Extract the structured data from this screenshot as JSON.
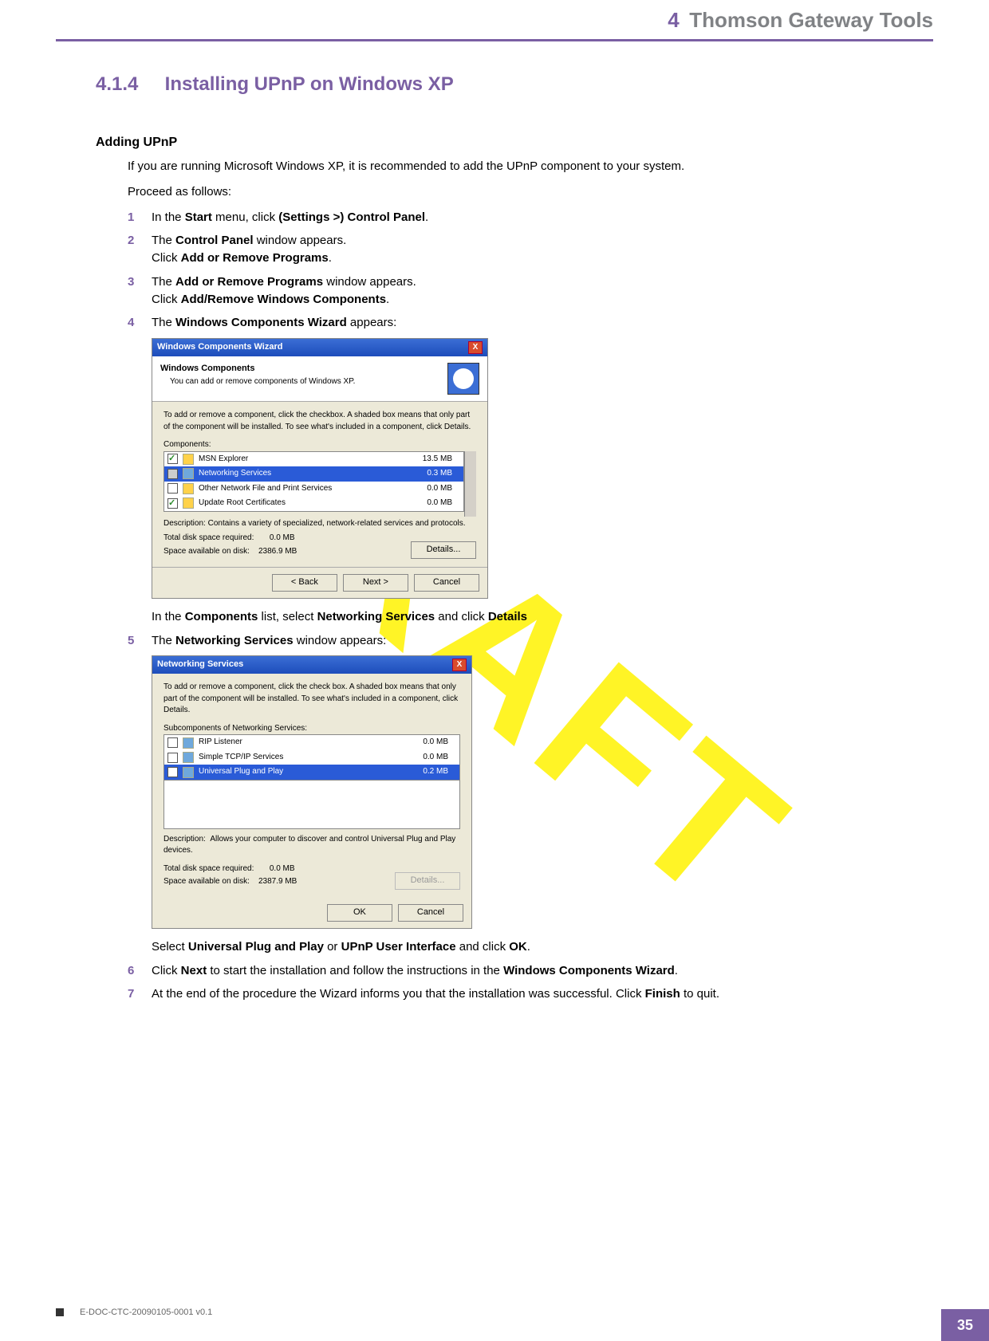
{
  "header": {
    "chapter_num": "4",
    "chapter_title": "Thomson Gateway Tools"
  },
  "section": {
    "number": "4.1.4",
    "title": "Installing UPnP on Windows XP"
  },
  "subheading": "Adding UPnP",
  "intro": {
    "p1": "If you are running Microsoft Windows XP, it is recommended to add the UPnP component to your system.",
    "p2": "Proceed as follows:"
  },
  "steps": {
    "s1": {
      "num": "1",
      "t1": "In the ",
      "b1": "Start",
      "t2": " menu, click ",
      "b2": "(Settings >) Control Panel",
      "t3": "."
    },
    "s2": {
      "num": "2",
      "l1_t1": "The ",
      "l1_b1": "Control Panel",
      "l1_t2": " window appears.",
      "l2_t1": "Click ",
      "l2_b1": "Add or Remove Programs",
      "l2_t2": "."
    },
    "s3": {
      "num": "3",
      "l1_t1": "The ",
      "l1_b1": "Add or Remove Programs",
      "l1_t2": " window appears.",
      "l2_t1": "Click ",
      "l2_b1": "Add/Remove Windows Components",
      "l2_t2": "."
    },
    "s4": {
      "num": "4",
      "l1_t1": "The ",
      "l1_b1": "Windows Components Wizard",
      "l1_t2": " appears:",
      "after_t1": "In the ",
      "after_b1": "Components",
      "after_t2": " list, select ",
      "after_b2": "Networking Services",
      "after_t3": " and click ",
      "after_b3": "Details"
    },
    "s5": {
      "num": "5",
      "l1_t1": "The ",
      "l1_b1": "Networking Services",
      "l1_t2": " window appears:",
      "after_t1": "Select ",
      "after_b1": "Universal Plug and Play",
      "after_t2": " or ",
      "after_b2": "UPnP User Interface",
      "after_t3": " and click ",
      "after_b3": "OK",
      "after_t4": "."
    },
    "s6": {
      "num": "6",
      "t1": "Click ",
      "b1": "Next",
      "t2": " to start the installation and follow the instructions in the ",
      "b2": "Windows Components Wizard",
      "t3": "."
    },
    "s7": {
      "num": "7",
      "t1": "At the end of the procedure the Wizard informs you that the installation was successful. Click ",
      "b1": "Finish",
      "t2": " to quit."
    }
  },
  "dialog1": {
    "title": "Windows Components Wizard",
    "head_title": "Windows Components",
    "head_sub": "You can add or remove components of Windows XP.",
    "body_desc": "To add or remove a component, click the checkbox. A shaded box means that only part of the component will be installed. To see what's included in a component, click Details.",
    "components_label": "Components:",
    "rows": [
      {
        "name": "MSN Explorer",
        "size": "13.5 MB",
        "checked": true
      },
      {
        "name": "Networking Services",
        "size": "0.3 MB",
        "selected": true,
        "shaded": true
      },
      {
        "name": "Other Network File and Print Services",
        "size": "0.0 MB"
      },
      {
        "name": "Update Root Certificates",
        "size": "0.0 MB",
        "checked": true
      }
    ],
    "desc_label": "Description:",
    "desc_text": "Contains a variety of specialized, network-related services and protocols.",
    "total_label": "Total disk space required:",
    "total_val": "0.0 MB",
    "avail_label": "Space available on disk:",
    "avail_val": "2386.9 MB",
    "btn_details": "Details...",
    "btn_back": "< Back",
    "btn_next": "Next >",
    "btn_cancel": "Cancel"
  },
  "dialog2": {
    "title": "Networking Services",
    "body_desc": "To add or remove a component, click the check box. A shaded box means that only part of the component will be installed. To see what's included in a component, click Details.",
    "sub_label": "Subcomponents of Networking Services:",
    "rows": [
      {
        "name": "RIP Listener",
        "size": "0.0 MB"
      },
      {
        "name": "Simple TCP/IP Services",
        "size": "0.0 MB"
      },
      {
        "name": "Universal Plug and Play",
        "size": "0.2 MB",
        "selected": true,
        "checked": true
      }
    ],
    "desc_label": "Description:",
    "desc_text": "Allows your computer to discover and control Universal Plug and Play devices.",
    "total_label": "Total disk space required:",
    "total_val": "0.0 MB",
    "avail_label": "Space available on disk:",
    "avail_val": "2387.9 MB",
    "btn_details": "Details...",
    "btn_ok": "OK",
    "btn_cancel": "Cancel"
  },
  "watermark": "DRAFT",
  "footer": {
    "doc": "E-DOC-CTC-20090105-0001 v0.1",
    "page": "35"
  }
}
